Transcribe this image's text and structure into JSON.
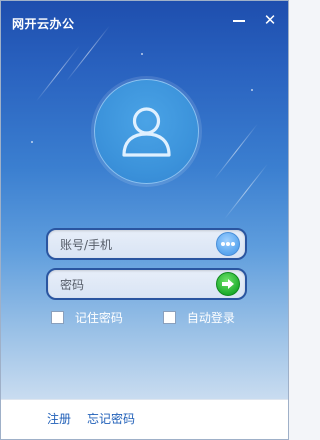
{
  "window": {
    "title": "网开云办公",
    "min_icon": "minimize-icon",
    "close_icon": "close-icon",
    "close_glyph": "✕"
  },
  "colors": {
    "sky_top": "#1e4eae",
    "sky_bottom": "#c9dcf0",
    "field_border": "#2a55a0",
    "login_button": "#1aaa2a",
    "link": "#1f5fb8"
  },
  "avatar": {
    "icon": "user-icon"
  },
  "login": {
    "account_placeholder": "账号/手机",
    "account_action_icon": "more-dots-icon",
    "password_placeholder": "密码",
    "submit_icon": "arrow-right-icon"
  },
  "options": {
    "remember_password": {
      "label": "记住密码",
      "checked": false
    },
    "auto_login": {
      "label": "自动登录",
      "checked": false
    }
  },
  "footer": {
    "register": "注册",
    "forgot_password": "忘记密码"
  }
}
